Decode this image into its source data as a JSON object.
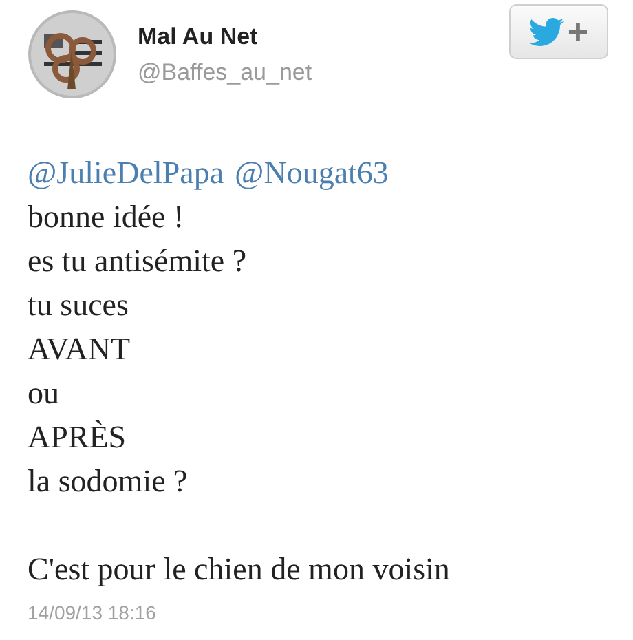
{
  "author": {
    "name": "Mal Au Net",
    "handle": "@Baffes_au_net"
  },
  "follow_button": {
    "label": "+"
  },
  "tweet": {
    "mentions": [
      "@JulieDelPapa",
      "@Nougat63"
    ],
    "lines": [
      "bonne idée !",
      "es tu antisémite ?",
      "tu suces",
      "AVANT",
      "ou",
      "APRÈS",
      "la sodomie ?"
    ],
    "closing": "C'est pour le chien de mon voisin",
    "timestamp": "14/09/13 18:16"
  }
}
